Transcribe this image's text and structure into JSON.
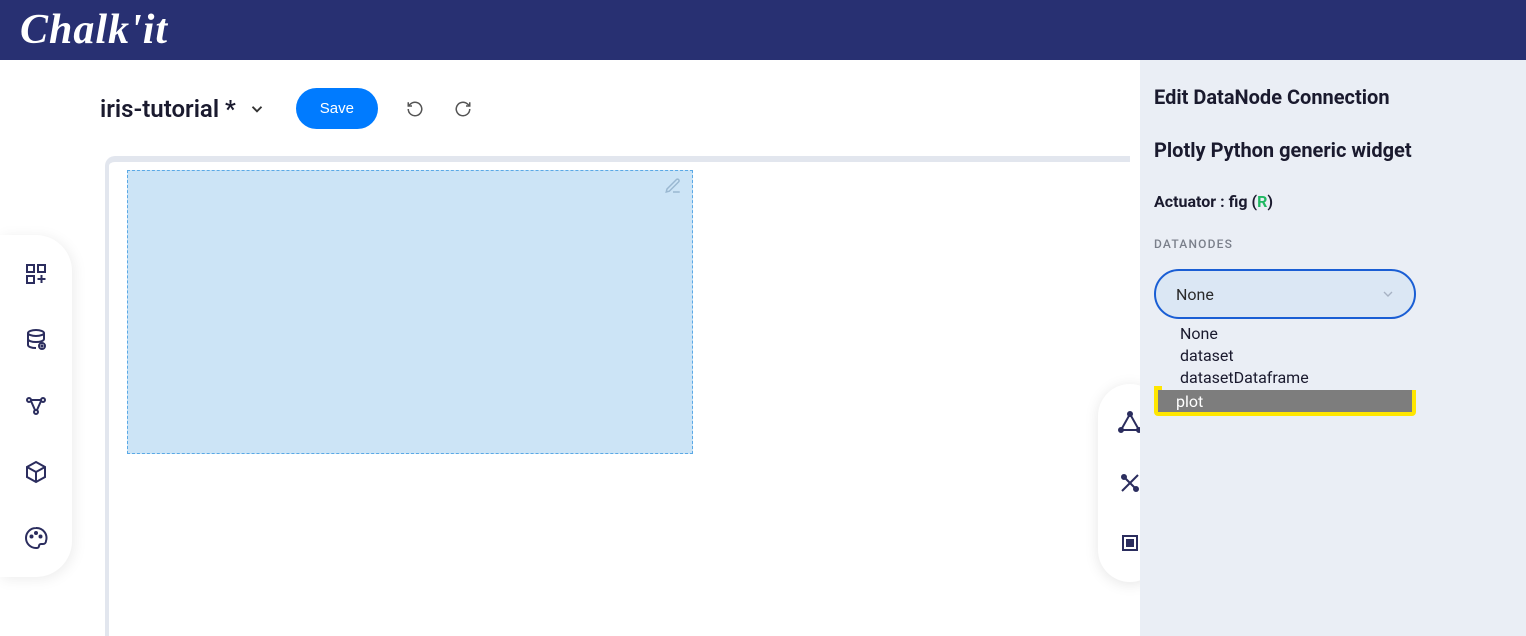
{
  "app": {
    "logo": "Chalk'it"
  },
  "topbar": {
    "project_title": "iris-tutorial *",
    "save_label": "Save"
  },
  "side_panel": {
    "title": "Edit DataNode Connection",
    "subtitle": "Plotly Python generic widget",
    "actuator_label": "Actuator : ",
    "actuator_value": "fig",
    "actuator_badge": "R",
    "section_label": "DATANODES",
    "selected": "None",
    "options": [
      "None",
      "dataset",
      "datasetDataframe",
      "plot"
    ]
  },
  "left_rail": {
    "icons": [
      "grid-icon",
      "database-icon",
      "graph-icon",
      "package-icon",
      "palette-icon"
    ]
  },
  "right_rail": {
    "icons": [
      "shape-icon",
      "tools-icon",
      "crop-icon"
    ]
  }
}
